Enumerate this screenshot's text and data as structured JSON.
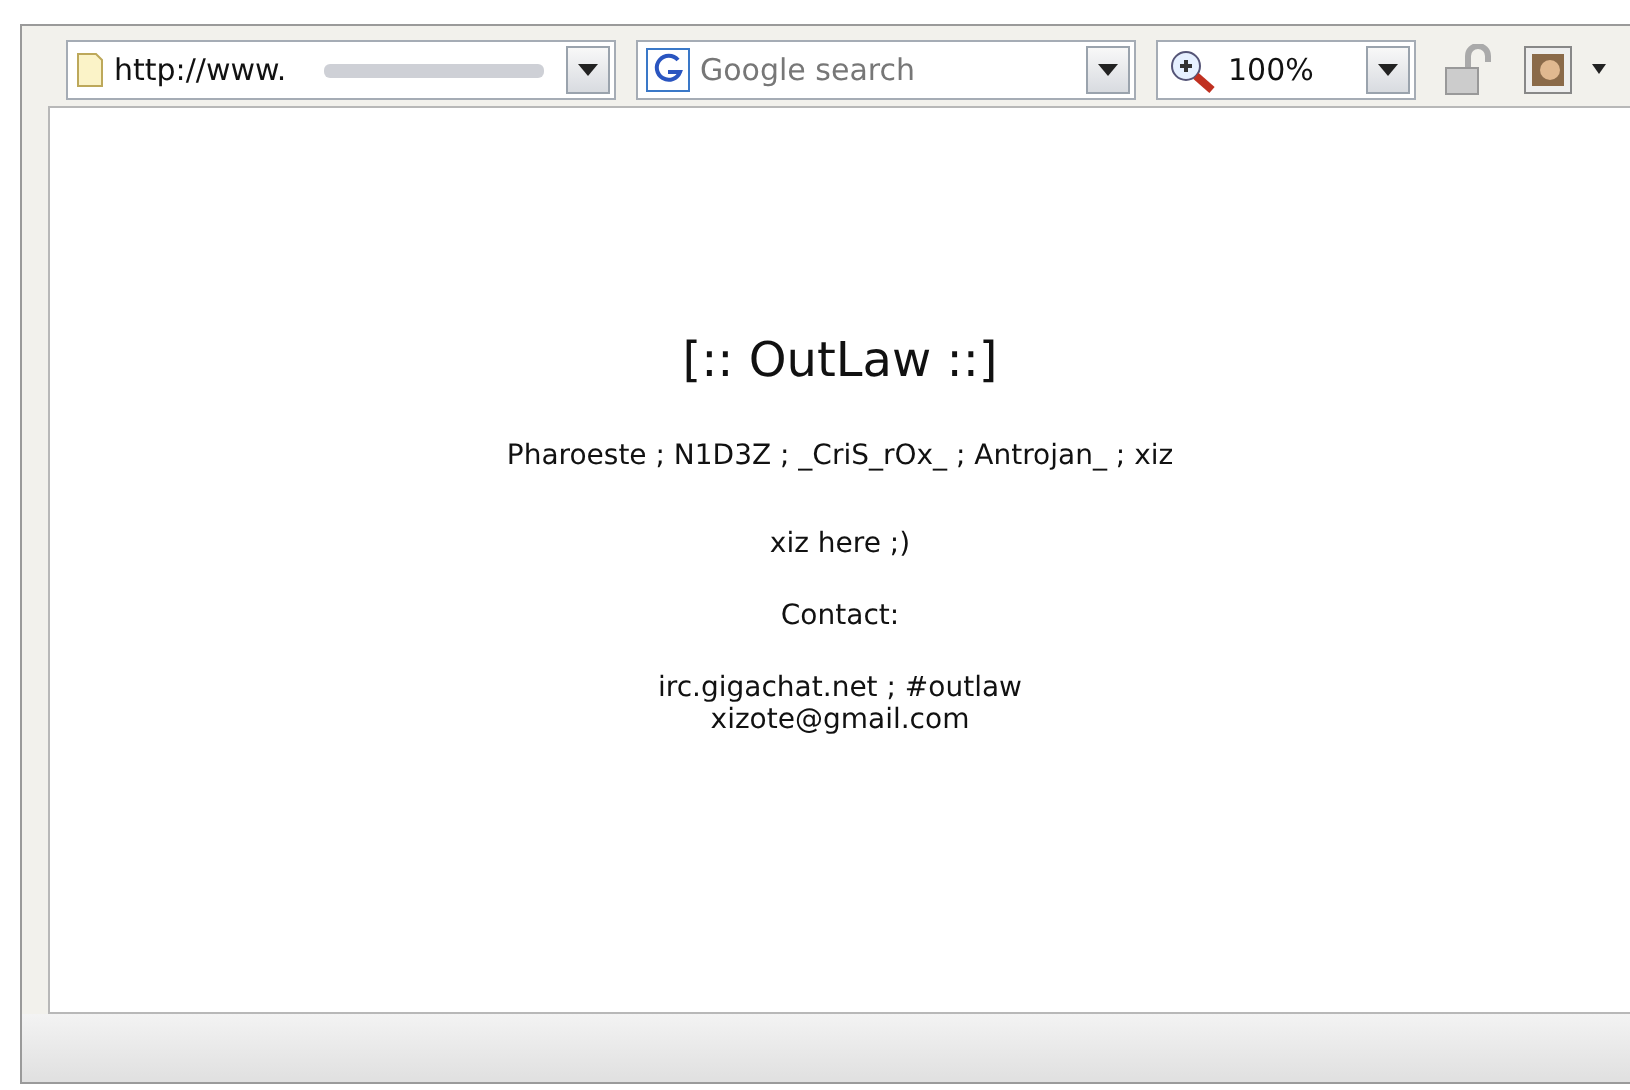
{
  "toolbar": {
    "address": {
      "value": "http://www."
    },
    "search": {
      "placeholder": "Google search"
    },
    "zoom": {
      "value": "100%"
    }
  },
  "page": {
    "title": "[:: OutLaw ::]",
    "members": "Pharoeste ; N1D3Z ; _CriS_rOx_ ; Antrojan_ ; xiz",
    "note": "xiz here ;)",
    "contact_label": "Contact:",
    "contact_lines": [
      "irc.gigachat.net ; #outlaw",
      "xizote@gmail.com"
    ]
  }
}
